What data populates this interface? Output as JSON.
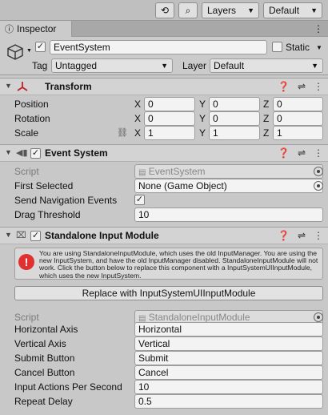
{
  "toolbar": {
    "layers": "Layers",
    "layout": "Default"
  },
  "tab": {
    "label": "Inspector"
  },
  "gameobject": {
    "name": "EventSystem",
    "static_label": "Static",
    "tag_label": "Tag",
    "tag_value": "Untagged",
    "layer_label": "Layer",
    "layer_value": "Default"
  },
  "transform": {
    "title": "Transform",
    "position_label": "Position",
    "rotation_label": "Rotation",
    "scale_label": "Scale",
    "axis_x": "X",
    "axis_y": "Y",
    "axis_z": "Z",
    "position": [
      "0",
      "0",
      "0"
    ],
    "rotation": [
      "0",
      "0",
      "0"
    ],
    "scale": [
      "1",
      "1",
      "1"
    ]
  },
  "event_system": {
    "title": "Event System",
    "script_label": "Script",
    "script_value": "EventSystem",
    "first_selected_label": "First Selected",
    "first_selected_value": "None (Game Object)",
    "send_nav_label": "Send Navigation Events",
    "drag_threshold_label": "Drag Threshold",
    "drag_threshold_value": "10"
  },
  "standalone": {
    "title": "Standalone Input Module",
    "help_text": "You are using StandaloneInputModule, which uses the old InputManager. You are using the new InputSystem, and have the old InputManager disabled. StandaloneInputModule will not work. Click the button below to replace this component with a InputSystemUIInputModule, which uses the new InputSystem.",
    "replace_button": "Replace with InputSystemUIInputModule",
    "script_label": "Script",
    "script_value": "StandaloneInputModule",
    "horizontal_axis_label": "Horizontal Axis",
    "horizontal_axis_value": "Horizontal",
    "vertical_axis_label": "Vertical Axis",
    "vertical_axis_value": "Vertical",
    "submit_label": "Submit Button",
    "submit_value": "Submit",
    "cancel_label": "Cancel Button",
    "cancel_value": "Cancel",
    "input_actions_label": "Input Actions Per Second",
    "input_actions_value": "10",
    "repeat_delay_label": "Repeat Delay",
    "repeat_delay_value": "0.5"
  }
}
